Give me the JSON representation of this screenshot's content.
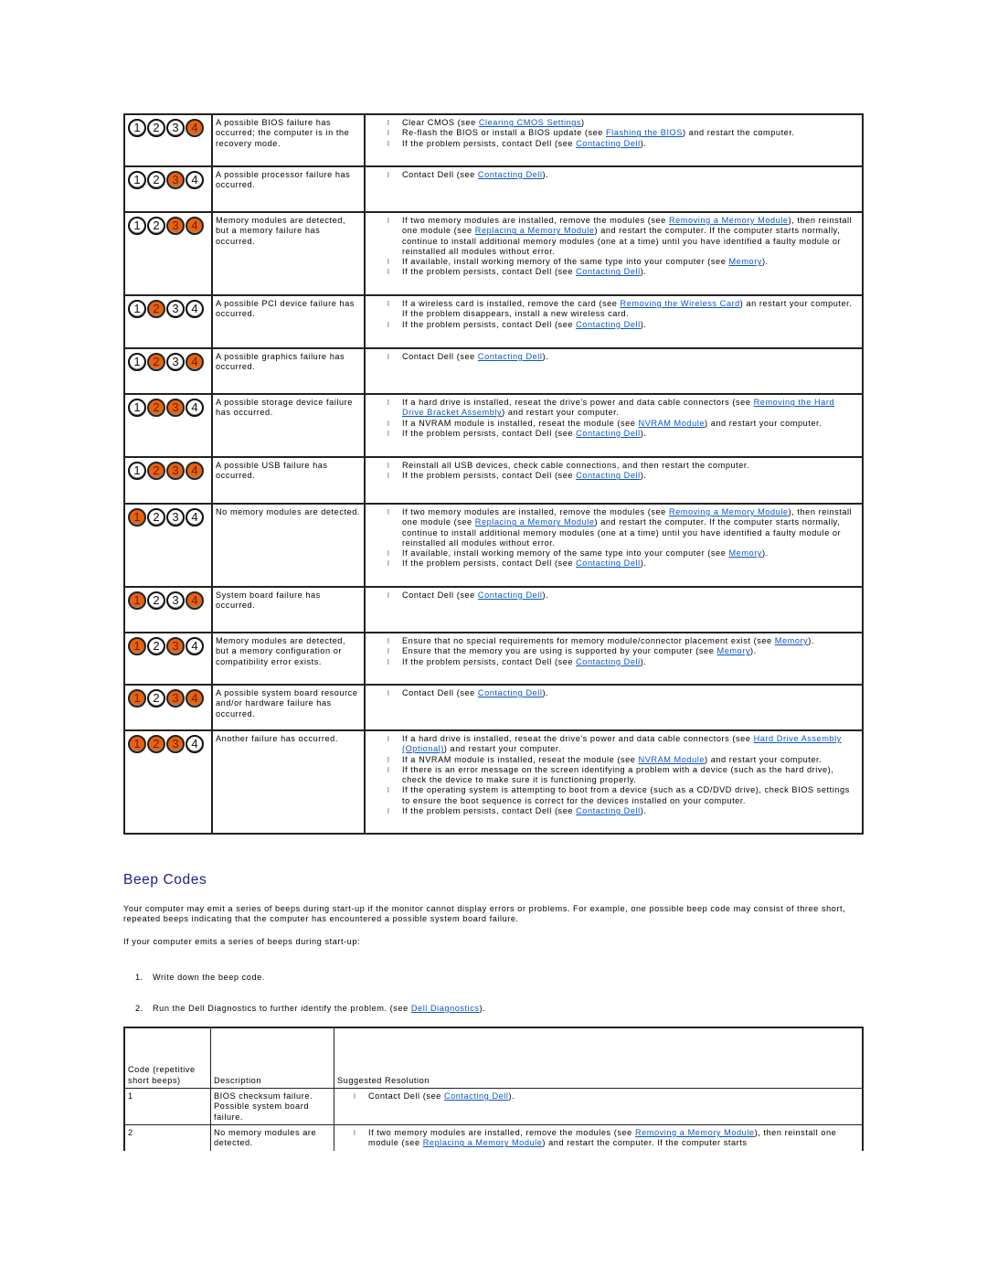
{
  "led_colors": {
    "on": "#e8620f",
    "off": "#ffffff"
  },
  "diagnostic_rows": [
    {
      "leds": [
        false,
        false,
        false,
        true
      ],
      "description": "A possible BIOS failure has occurred; the computer is in the recovery mode.",
      "resolutions": [
        [
          {
            "t": "Clear CMOS (see "
          },
          {
            "link": "Clearing CMOS Settings"
          },
          {
            "t": ")"
          }
        ],
        [
          {
            "t": "Re-flash the BIOS or install a BIOS update (see "
          },
          {
            "link": "Flashing the BIOS"
          },
          {
            "t": ") and restart the computer."
          }
        ],
        [
          {
            "t": "If the problem persists, contact Dell (see "
          },
          {
            "link": "Contacting Dell"
          },
          {
            "t": ")."
          }
        ]
      ]
    },
    {
      "leds": [
        false,
        false,
        true,
        false
      ],
      "description": "A possible processor failure has occurred.",
      "resolutions": [
        [
          {
            "t": "Contact Dell (see "
          },
          {
            "link": "Contacting Dell"
          },
          {
            "t": ")."
          }
        ]
      ]
    },
    {
      "leds": [
        false,
        false,
        true,
        true
      ],
      "description": "Memory modules are detected, but a memory failure has occurred.",
      "resolutions": [
        [
          {
            "t": "If two memory modules are installed, remove the modules (see "
          },
          {
            "link": "Removing a Memory Module"
          },
          {
            "t": "), then reinstall one module (see "
          },
          {
            "link": "Replacing a Memory Module"
          },
          {
            "t": ") and restart the computer. If the computer starts normally, continue to install additional memory modules (one at a time) until you have identified a faulty module or reinstalled all modules without error."
          }
        ],
        [
          {
            "t": "If available, install working memory of the same type into your computer (see "
          },
          {
            "link": "Memory"
          },
          {
            "t": ")."
          }
        ],
        [
          {
            "t": "If the problem persists, contact Dell (see "
          },
          {
            "link": "Contacting Dell"
          },
          {
            "t": ")."
          }
        ]
      ]
    },
    {
      "leds": [
        false,
        true,
        false,
        false
      ],
      "description": "A possible PCI device failure has occurred.",
      "resolutions": [
        [
          {
            "t": "If a wireless card is installed, remove the card (see "
          },
          {
            "link": "Removing the Wireless Card"
          },
          {
            "t": ") an restart your computer. If the problem disappears, install a new wireless card."
          }
        ],
        [
          {
            "t": "If the problem persists, contact Dell (see "
          },
          {
            "link": "Contacting Dell"
          },
          {
            "t": ")."
          }
        ]
      ]
    },
    {
      "leds": [
        false,
        true,
        false,
        true
      ],
      "description": "A possible graphics failure has occurred.",
      "resolutions": [
        [
          {
            "t": "Contact Dell (see "
          },
          {
            "link": "Contacting Dell"
          },
          {
            "t": ")."
          }
        ]
      ]
    },
    {
      "leds": [
        false,
        true,
        true,
        false
      ],
      "description": "A possible storage device failure has occurred.",
      "resolutions": [
        [
          {
            "t": "If a hard drive is installed, reseat the drive's power and data cable connectors (see "
          },
          {
            "link": "Removing the Hard Drive Bracket Assembly"
          },
          {
            "t": ") and restart your computer."
          }
        ],
        [
          {
            "t": "If a NVRAM module is installed, reseat the module (see "
          },
          {
            "link": "NVRAM Module"
          },
          {
            "t": ") and restart your computer."
          }
        ],
        [
          {
            "t": "If the problem persists, contact Dell (see "
          },
          {
            "link": "Contacting Dell"
          },
          {
            "t": ")."
          }
        ]
      ]
    },
    {
      "leds": [
        false,
        true,
        true,
        true
      ],
      "description": "A possible USB failure has occurred.",
      "resolutions": [
        [
          {
            "t": "Reinstall all USB devices, check cable connections, and then restart the computer."
          }
        ],
        [
          {
            "t": "If the problem persists, contact Dell (see "
          },
          {
            "link": "Contacting Dell"
          },
          {
            "t": ")."
          }
        ]
      ]
    },
    {
      "leds": [
        true,
        false,
        false,
        false
      ],
      "description": "No memory modules are detected.",
      "resolutions": [
        [
          {
            "t": "If two memory modules are installed, remove the modules (see "
          },
          {
            "link": "Removing a Memory Module"
          },
          {
            "t": "), then reinstall one module (see "
          },
          {
            "link": "Replacing a Memory Module"
          },
          {
            "t": ") and restart the computer. If the computer starts normally, continue to install additional memory modules (one at a time) until you have identified a faulty module or reinstalled all modules without error."
          }
        ],
        [
          {
            "t": "If available, install working memory of the same type into your computer (see "
          },
          {
            "link": "Memory"
          },
          {
            "t": ")."
          }
        ],
        [
          {
            "t": "If the problem persists, contact Dell (see "
          },
          {
            "link": "Contacting Dell"
          },
          {
            "t": ")."
          }
        ]
      ]
    },
    {
      "leds": [
        true,
        false,
        false,
        true
      ],
      "description": "System board failure has occurred.",
      "resolutions": [
        [
          {
            "t": "Contact Dell (see "
          },
          {
            "link": "Contacting Dell"
          },
          {
            "t": ")."
          }
        ]
      ]
    },
    {
      "leds": [
        true,
        false,
        true,
        false
      ],
      "description": "Memory modules are detected, but a memory configuration or compatibility error exists.",
      "resolutions": [
        [
          {
            "t": "Ensure that no special requirements for memory module/connector placement exist (see "
          },
          {
            "link": "Memory"
          },
          {
            "t": ")."
          }
        ],
        [
          {
            "t": "Ensure that the memory you are using is supported by your computer (see "
          },
          {
            "link": "Memory"
          },
          {
            "t": ")."
          }
        ],
        [
          {
            "t": "If the problem persists, contact Dell (see "
          },
          {
            "link": "Contacting Dell"
          },
          {
            "t": ")."
          }
        ]
      ]
    },
    {
      "leds": [
        true,
        false,
        true,
        true
      ],
      "description": "A possible system board resource and/or hardware failure has occurred.",
      "resolutions": [
        [
          {
            "t": "Contact Dell (see "
          },
          {
            "link": "Contacting Dell"
          },
          {
            "t": ")."
          }
        ]
      ]
    },
    {
      "leds": [
        true,
        true,
        true,
        false
      ],
      "description": "Another failure has occurred.",
      "resolutions": [
        [
          {
            "t": "If a hard drive is installed, reseat the drive's power and data cable connectors (see "
          },
          {
            "link": "Hard Drive Assembly (Optional)"
          },
          {
            "t": ") and restart your computer."
          }
        ],
        [
          {
            "t": "If a NVRAM module is installed, reseat the module (see "
          },
          {
            "link": "NVRAM Module"
          },
          {
            "t": ") and restart your computer."
          }
        ],
        [
          {
            "t": "If there is an error message on the screen identifying a problem with a device (such as the hard drive), check the device to make sure it is functioning properly."
          }
        ],
        [
          {
            "t": "If the operating system is attempting to boot from a device (such as a CD/DVD drive), check BIOS settings to ensure the boot sequence is correct for the devices installed on your computer."
          }
        ],
        [
          {
            "t": "If the problem persists, contact Dell (see "
          },
          {
            "link": "Contacting Dell"
          },
          {
            "t": ")."
          }
        ]
      ]
    }
  ],
  "beep_codes": {
    "title": "Beep Codes",
    "intro": "Your computer may emit a series of beeps during start-up if the monitor cannot display errors or problems. For example, one possible beep code may consist of three short, repeated beeps indicating that the computer has encountered a possible system board failure.",
    "lead_in": "If your computer emits a series of beeps during start-up:",
    "steps": [
      {
        "num": "1.",
        "text": "Write down the beep code.",
        "link": null,
        "after": ""
      },
      {
        "num": "2.",
        "text": "Run the Dell Diagnostics to further identify the problem. (see ",
        "link": "Dell Diagnostics",
        "after": ")."
      }
    ],
    "table": {
      "headers": [
        "Code (repetitive short beeps)",
        "Description",
        "Suggested Resolution"
      ],
      "rows": [
        {
          "code": "1",
          "description": "BIOS checksum failure. Possible system board failure.",
          "resolutions": [
            [
              {
                "t": "Contact Dell (see "
              },
              {
                "link": "Contacting Dell"
              },
              {
                "t": ")."
              }
            ]
          ]
        },
        {
          "code": "2",
          "description": "No memory modules are detected.",
          "resolutions": [
            [
              {
                "t": "If two memory modules are installed, remove the modules (see "
              },
              {
                "link": "Removing a Memory Module"
              },
              {
                "t": "), then reinstall one module (see "
              },
              {
                "link": "Replacing a Memory Module"
              },
              {
                "t": ") and restart the computer. If the computer starts"
              }
            ]
          ]
        }
      ]
    }
  },
  "bullet_glyph": "l"
}
